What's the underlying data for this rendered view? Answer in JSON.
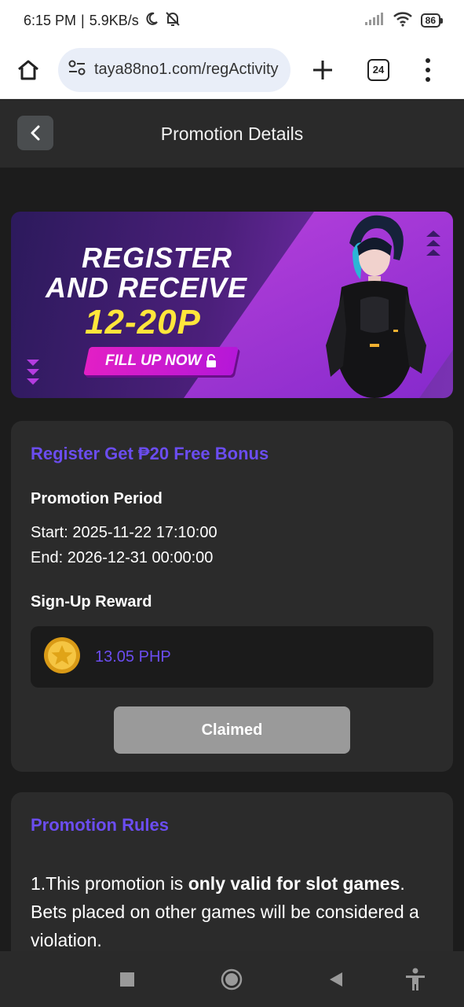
{
  "status_bar": {
    "time": "6:15 PM",
    "separator": "|",
    "speed": "5.9KB/s",
    "battery": "86"
  },
  "browser": {
    "url": "taya88no1.com/regActivity",
    "tab_count": "24"
  },
  "header": {
    "title": "Promotion Details"
  },
  "banner": {
    "line1": "REGISTER",
    "line2": "AND RECEIVE",
    "line3": "12-20P",
    "cta": "FILL UP NOW"
  },
  "promotion": {
    "title": "Register Get ₱20 Free Bonus",
    "period_label": "Promotion Period",
    "start": "Start: 2025-11-22 17:10:00",
    "end": "End: 2026-12-31 00:00:00",
    "reward_label": "Sign-Up Reward",
    "reward_amount": "13.05 PHP",
    "claimed_label": "Claimed"
  },
  "rules": {
    "title": "Promotion Rules",
    "rule1_prefix": "1.This promotion is ",
    "rule1_bold": "only valid for slot games",
    "rule1_suffix": ". Bets placed on other games will be considered a violation."
  },
  "colors": {
    "accent": "#6b4df0",
    "background": "#1c1c1c",
    "card": "#2b2b2b",
    "highlight_yellow": "#ffe63b"
  }
}
